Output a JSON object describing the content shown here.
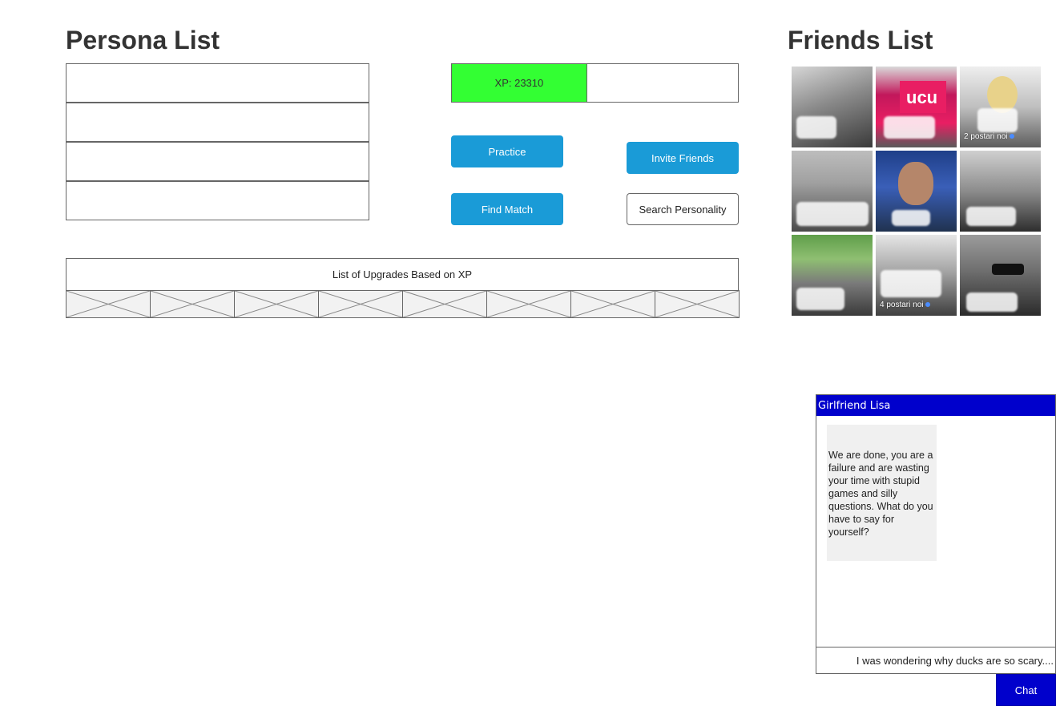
{
  "persona": {
    "title": "Persona List",
    "slots": [
      "",
      "",
      "",
      ""
    ]
  },
  "xp": {
    "label": "XP: 23310",
    "fill_fraction": 0.47,
    "fill_color": "#33ff33"
  },
  "buttons": {
    "practice": "Practice",
    "invite": "Invite Friends",
    "find_match": "Find Match",
    "search": "Search Personality"
  },
  "upgrades": {
    "header": "List of Upgrades Based on XP",
    "cell_count": 8
  },
  "friends": {
    "title": "Friends List",
    "tiles": [
      {
        "name": "",
        "sub": ""
      },
      {
        "name": "",
        "sub": ""
      },
      {
        "name": "",
        "sub": "2 postari noi"
      },
      {
        "name": "",
        "sub": ""
      },
      {
        "name": "",
        "sub": ""
      },
      {
        "name": "",
        "sub": ""
      },
      {
        "name": "",
        "sub": ""
      },
      {
        "name": "",
        "sub": "4 postari noi"
      },
      {
        "name": "",
        "sub": ""
      }
    ]
  },
  "chat": {
    "title": "Girlfriend Lisa",
    "message": "We are done, you are a failure and are wasting your time with stupid games and silly questions. What do you have to say for yourself?",
    "input_value": "I was wondering why ducks are so scary....",
    "send_label": "Chat",
    "accent_color": "#0000cc"
  }
}
